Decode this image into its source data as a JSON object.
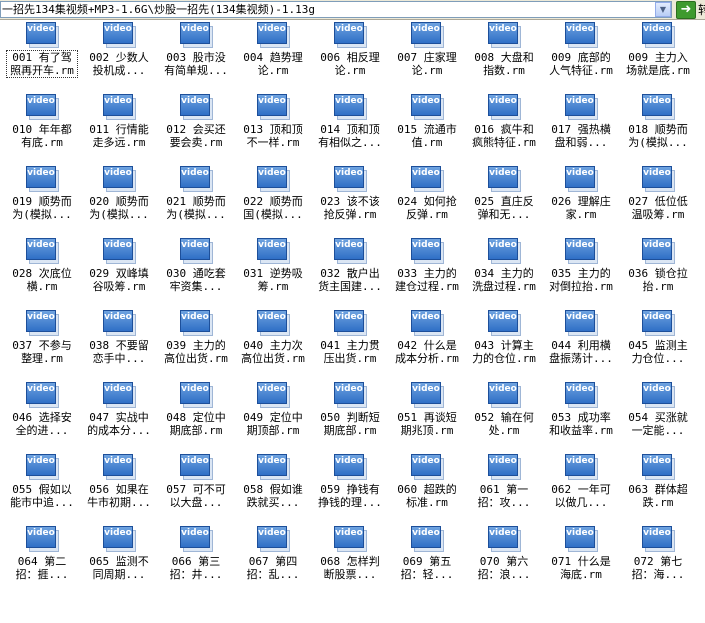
{
  "address_bar": {
    "path": "一招先134集视频+MP3-1.6G\\炒股一招先(134集视频)-1.13g",
    "go_label": "转"
  },
  "icon": {
    "text": "video",
    "semantic": "video-file-icon",
    "color": "#2f6fc6"
  },
  "files": [
    {
      "line1": "001 有了驾",
      "line2": "照再开车.rm"
    },
    {
      "line1": "002 少数人",
      "line2": "投机成..."
    },
    {
      "line1": "003 股市没",
      "line2": "有简单规..."
    },
    {
      "line1": "004 趋势理",
      "line2": "论.rm"
    },
    {
      "line1": "006 相反理",
      "line2": "论.rm"
    },
    {
      "line1": "007 庄家理",
      "line2": "论.rm"
    },
    {
      "line1": "008 大盘和",
      "line2": "指数.rm"
    },
    {
      "line1": "009 底部的",
      "line2": "人气特征.rm"
    },
    {
      "line1": "009 主力入",
      "line2": "场就是底.rm"
    },
    {
      "line1": "010 年年都",
      "line2": "有底.rm"
    },
    {
      "line1": "011 行情能",
      "line2": "走多远.rm"
    },
    {
      "line1": "012 会买还",
      "line2": "要会卖.rm"
    },
    {
      "line1": "013 顶和顶",
      "line2": "不一样.rm"
    },
    {
      "line1": "014 顶和顶",
      "line2": "有相似之..."
    },
    {
      "line1": "015 流通市",
      "line2": "值.rm"
    },
    {
      "line1": "016 疯牛和",
      "line2": "疯熊特征.rm"
    },
    {
      "line1": "017 强热横",
      "line2": "盘和弱..."
    },
    {
      "line1": "018 顺势而",
      "line2": "为(模拟..."
    },
    {
      "line1": "019 顺势而",
      "line2": "为(模拟..."
    },
    {
      "line1": "020 顺势而",
      "line2": "为(模拟..."
    },
    {
      "line1": "021 顺势而",
      "line2": "为(模拟..."
    },
    {
      "line1": "022 顺势而",
      "line2": "国(模拟..."
    },
    {
      "line1": "023 该不该",
      "line2": "抢反弹.rm"
    },
    {
      "line1": "024 如何抢",
      "line2": "反弹.rm"
    },
    {
      "line1": "025 直庄反",
      "line2": "弹和无..."
    },
    {
      "line1": "026 理解庄",
      "line2": "家.rm"
    },
    {
      "line1": "027 低位低",
      "line2": "温吸筹.rm"
    },
    {
      "line1": "028 次底位",
      "line2": "横.rm"
    },
    {
      "line1": "029 双峰填",
      "line2": "谷吸筹.rm"
    },
    {
      "line1": "030 通吃套",
      "line2": "牢资集..."
    },
    {
      "line1": "031 逆势吸",
      "line2": "筹.rm"
    },
    {
      "line1": "032 散户出",
      "line2": "货主国建..."
    },
    {
      "line1": "033 主力的",
      "line2": "建仓过程.rm"
    },
    {
      "line1": "034 主力的",
      "line2": "洗盘过程.rm"
    },
    {
      "line1": "035 主力的",
      "line2": "对倒拉抬.rm"
    },
    {
      "line1": "036 锁仓拉",
      "line2": "抬.rm"
    },
    {
      "line1": "037 不参与",
      "line2": "整理.rm"
    },
    {
      "line1": "038 不要留",
      "line2": "恋手中..."
    },
    {
      "line1": "039 主力的",
      "line2": "高位出货.rm"
    },
    {
      "line1": "040 主力次",
      "line2": "高位出货.rm"
    },
    {
      "line1": "041 主力贯",
      "line2": "压出货.rm"
    },
    {
      "line1": "042 什么是",
      "line2": "成本分析.rm"
    },
    {
      "line1": "043 计算主",
      "line2": "力的仓位.rm"
    },
    {
      "line1": "044 利用横",
      "line2": "盘振荡计..."
    },
    {
      "line1": "045 监测主",
      "line2": "力仓位..."
    },
    {
      "line1": "046 选择安",
      "line2": "全的进..."
    },
    {
      "line1": "047 实战中",
      "line2": "的成本分..."
    },
    {
      "line1": "048 定位中",
      "line2": "期底部.rm"
    },
    {
      "line1": "049 定位中",
      "line2": "期顶部.rm"
    },
    {
      "line1": "050 判断短",
      "line2": "期底部.rm"
    },
    {
      "line1": "051 再谈短",
      "line2": "期兆顶.rm"
    },
    {
      "line1": "052 输在何",
      "line2": "处.rm"
    },
    {
      "line1": "053 成功率",
      "line2": "和收益率.rm"
    },
    {
      "line1": "054 买涨就",
      "line2": "一定能..."
    },
    {
      "line1": "055 假如以",
      "line2": "能市中追..."
    },
    {
      "line1": "056 如果在",
      "line2": "牛市初期..."
    },
    {
      "line1": "057 可不可",
      "line2": "以大盘..."
    },
    {
      "line1": "058 假如谁",
      "line2": "跌就买..."
    },
    {
      "line1": "059 挣钱有",
      "line2": "挣钱的理..."
    },
    {
      "line1": "060 超跌的",
      "line2": "标准.rm"
    },
    {
      "line1": "061 第一",
      "line2": "招：攻..."
    },
    {
      "line1": "062 一年可",
      "line2": "以做几..."
    },
    {
      "line1": "063 群体超",
      "line2": "跌.rm"
    },
    {
      "line1": "064 第二",
      "line2": "招：捱..."
    },
    {
      "line1": "065 监测不",
      "line2": "同周期..."
    },
    {
      "line1": "066 第三",
      "line2": "招：井..."
    },
    {
      "line1": "067 第四",
      "line2": "招：乱..."
    },
    {
      "line1": "068 怎样判",
      "line2": "断股票..."
    },
    {
      "line1": "069 第五",
      "line2": "招：轻..."
    },
    {
      "line1": "070 第六",
      "line2": "招：浪..."
    },
    {
      "line1": "071 什么是",
      "line2": "海底.rm"
    },
    {
      "line1": "072 第七",
      "line2": "招：海..."
    }
  ]
}
